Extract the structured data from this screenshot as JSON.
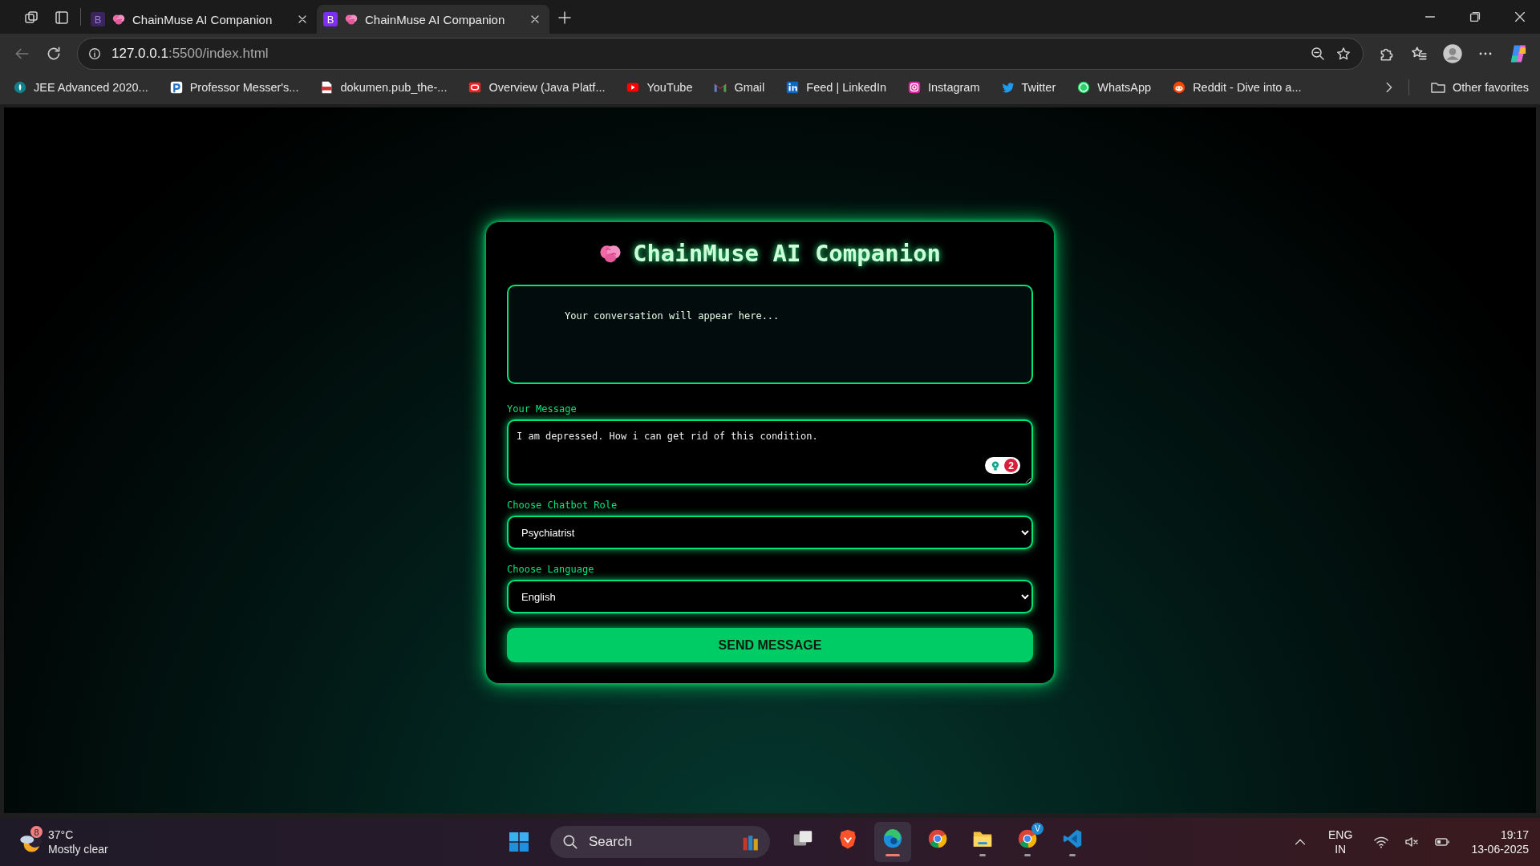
{
  "browser": {
    "tabs": [
      {
        "favicon_letter": "B",
        "title": "ChainMuse AI Companion",
        "selected": false
      },
      {
        "favicon_letter": "B",
        "title": "ChainMuse AI Companion",
        "selected": true
      }
    ],
    "address": {
      "host": "127.0.0.1",
      "path": ":5500/index.html"
    },
    "bookmarks": [
      {
        "kind": "drop",
        "label": "JEE Advanced 2020..."
      },
      {
        "kind": "arc",
        "label": "Professor Messer's..."
      },
      {
        "kind": "document",
        "label": "dokumen.pub_the-..."
      },
      {
        "kind": "ring",
        "label": "Overview (Java Platf..."
      },
      {
        "kind": "play",
        "label": "YouTube"
      },
      {
        "kind": "mail",
        "label": "Gmail"
      },
      {
        "kind": "square",
        "label": "Feed | LinkedIn"
      },
      {
        "kind": "camera",
        "label": "Instagram"
      },
      {
        "kind": "bird",
        "label": "Twitter"
      },
      {
        "kind": "chat",
        "label": "WhatsApp"
      },
      {
        "kind": "face",
        "label": "Reddit - Dive into a..."
      }
    ],
    "other_favorites": "Other favorites"
  },
  "app": {
    "title": "ChainMuse AI Companion",
    "conversation_text": "Your conversation will appear here...",
    "message": {
      "label": "Your Message",
      "value": "I am depressed. How i can get rid of this condition.",
      "issue_count": "2"
    },
    "role": {
      "label": "Choose Chatbot Role",
      "value": "Psychiatrist"
    },
    "language": {
      "label": "Choose Language",
      "value": "English"
    },
    "send_button": "SEND MESSAGE"
  },
  "taskbar": {
    "weather": {
      "badge": "8",
      "temperature": "37°C",
      "condition": "Mostly clear"
    },
    "search": "Search",
    "apps": [
      {
        "kind": "taskview",
        "running": false,
        "active": false
      },
      {
        "kind": "shield",
        "running": false,
        "active": false
      },
      {
        "kind": "edge",
        "running": true,
        "active": true
      },
      {
        "kind": "chrome",
        "running": false,
        "active": false
      },
      {
        "kind": "folder",
        "running": true,
        "active": false
      },
      {
        "kind": "chrome",
        "running": true,
        "active": false,
        "badge": "V"
      },
      {
        "kind": "code",
        "running": true,
        "active": false
      }
    ],
    "input_language": "ENG",
    "input_region": "IN",
    "time": "19:17",
    "date": "13-06-2025"
  }
}
